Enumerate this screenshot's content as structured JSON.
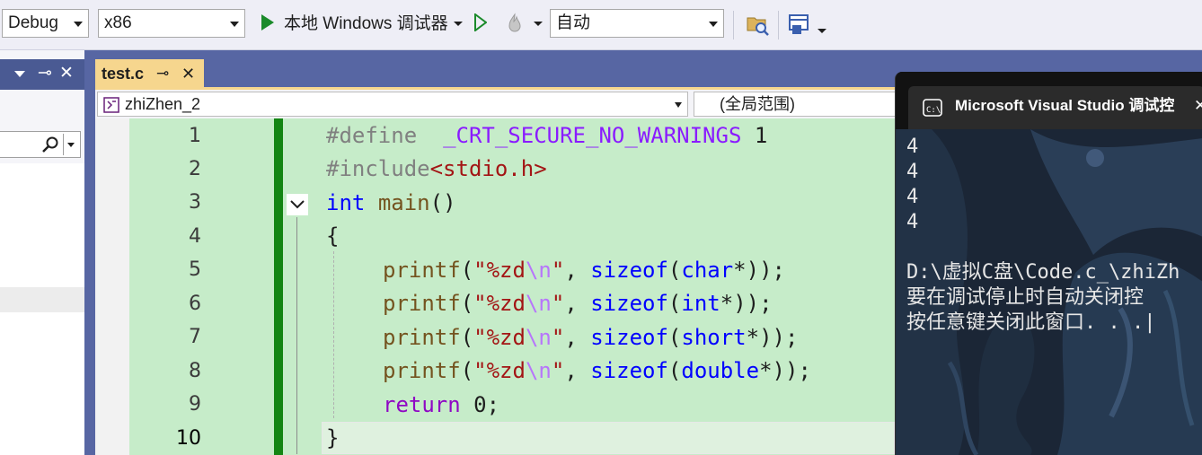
{
  "toolbar": {
    "config": "Debug",
    "platform": "x86",
    "debugger_label": "本地 Windows 调试器",
    "start_mode": "自动"
  },
  "tab": {
    "file": "test.c",
    "pin": "⊸",
    "close": "✕"
  },
  "nav": {
    "scope": "zhiZhen_2",
    "global": "(全局范围)"
  },
  "code": {
    "line_numbers": [
      "1",
      "2",
      "3",
      "4",
      "5",
      "6",
      "7",
      "8",
      "9",
      "10"
    ],
    "lines": [
      "#define  _CRT_SECURE_NO_WARNINGS 1",
      "#include<stdio.h>",
      "int main()",
      "{",
      "printf(\"%zd\\n\", sizeof(char*));",
      "printf(\"%zd\\n\", sizeof(int*));",
      "printf(\"%zd\\n\", sizeof(short*));",
      "printf(\"%zd\\n\", sizeof(double*));",
      "return 0;",
      "}"
    ]
  },
  "console": {
    "title": "Microsoft Visual Studio 调试控",
    "close": "✕",
    "output": [
      "4",
      "4",
      "4",
      "4",
      "",
      "D:\\虚拟C盘\\Code.c_\\zhiZh",
      "要在调试停止时自动关闭控",
      "按任意键关闭此窗口. . .|"
    ]
  },
  "left_panel": {
    "pin": "⊸",
    "close": "✕"
  }
}
